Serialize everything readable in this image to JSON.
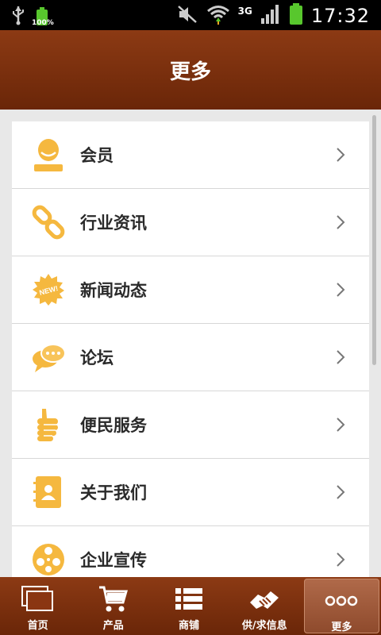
{
  "status_bar": {
    "battery_percent_label": "100%",
    "network_label": "3G",
    "time": "17:32",
    "icons": [
      "usb-icon",
      "battery-full-icon",
      "mute-icon",
      "wifi-icon",
      "signal-icon",
      "battery-icon"
    ]
  },
  "header": {
    "title": "更多"
  },
  "menu": {
    "items": [
      {
        "label": "会员",
        "icon": "member-icon"
      },
      {
        "label": "行业资讯",
        "icon": "link-icon"
      },
      {
        "label": "新闻动态",
        "icon": "new-badge-icon"
      },
      {
        "label": "论坛",
        "icon": "chat-bubbles-icon"
      },
      {
        "label": "便民服务",
        "icon": "thumbs-up-icon"
      },
      {
        "label": "关于我们",
        "icon": "contact-card-icon"
      },
      {
        "label": "企业宣传",
        "icon": "film-reel-icon"
      }
    ]
  },
  "new_badge_text": "NEW!",
  "bottom_nav": {
    "tabs": [
      {
        "label": "首页",
        "icon": "home-pages-icon"
      },
      {
        "label": "产品",
        "icon": "cart-icon"
      },
      {
        "label": "商铺",
        "icon": "list-icon"
      },
      {
        "label": "供/求信息",
        "icon": "handshake-icon"
      },
      {
        "label": "更多",
        "icon": "more-dots-icon",
        "active": true
      }
    ]
  },
  "colors": {
    "brand_brown": "#7a300e",
    "icon_orange": "#f5b83f",
    "background": "#e8e8e8"
  }
}
